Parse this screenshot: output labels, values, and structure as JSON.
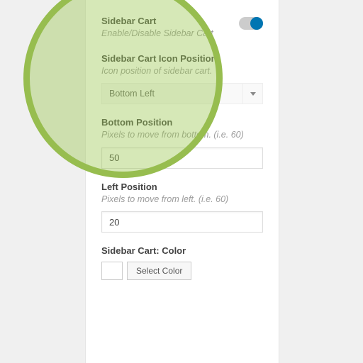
{
  "fields": {
    "sidebar_cart": {
      "label": "Sidebar Cart",
      "desc": "Enable/Disable Sidebar Cart"
    },
    "icon_position": {
      "label": "Sidebar Cart Icon Position",
      "desc": "Icon position of sidebar cart.",
      "value": "Bottom Left"
    },
    "bottom_position": {
      "label": "Bottom Position",
      "desc": "Pixels to move from bottom. (i.e. 60)",
      "value": "50"
    },
    "left_position": {
      "label": "Left Position",
      "desc": "Pixels to move from left. (i.e. 60)",
      "value": "20"
    },
    "color": {
      "label": "Sidebar Cart: Color",
      "button": "Select Color"
    }
  }
}
